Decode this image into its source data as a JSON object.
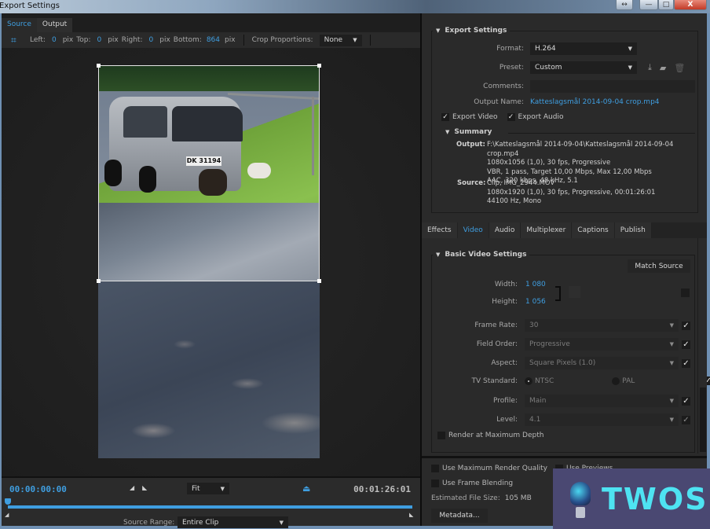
{
  "window": {
    "title": "Export Settings",
    "controls": {
      "swap": "↔",
      "minimize": "—",
      "maximize": "□",
      "close": "X"
    }
  },
  "left_panel": {
    "tabs": [
      {
        "label": "Source",
        "active": true
      },
      {
        "label": "Output",
        "active": false
      }
    ],
    "crop": {
      "icon": "crop-icon",
      "left_label": "Left:",
      "left_value": "0",
      "top_label": "Top:",
      "top_value": "0",
      "right_label": "Right:",
      "right_value": "0",
      "bottom_label": "Bottom:",
      "bottom_value": "864",
      "unit": "pix",
      "proportions_label": "Crop Proportions:",
      "proportions_value": "None"
    },
    "preview": {
      "plate_text": "DK 31194"
    },
    "timeline": {
      "current_time": "00:00:00:00",
      "end_time": "00:01:26:01",
      "zoom_value": "Fit",
      "source_range_label": "Source Range:",
      "source_range_value": "Entire Clip",
      "playhead_position": 0.0
    }
  },
  "right_panel": {
    "export_settings": {
      "title": "Export Settings",
      "format_label": "Format:",
      "format_value": "H.264",
      "preset_label": "Preset:",
      "preset_value": "Custom",
      "comments_label": "Comments:",
      "comments_value": "",
      "output_name_label": "Output Name:",
      "output_name_value": "Katteslagsmål 2014-09-04 crop.mp4",
      "export_video_label": "Export Video",
      "export_video_checked": true,
      "export_audio_label": "Export Audio",
      "export_audio_checked": true
    },
    "summary": {
      "title": "Summary",
      "output_label": "Output:",
      "output_lines": [
        "F:\\Katteslagsmål 2014-09-04\\Katteslagsmål 2014-09-04 crop.mp4",
        "1080x1056 (1,0), 30 fps, Progressive",
        "VBR, 1 pass, Target 10,00 Mbps, Max 12,00 Mbps",
        "AAC, 320 kbps, 48 kHz, 5.1"
      ],
      "source_label": "Source:",
      "source_lines": [
        "Clip, IMG_2944.MOV",
        "1080x1920 (1,0), 30 fps, Progressive, 00:01:26:01",
        "44100 Hz, Mono"
      ]
    },
    "tabs": [
      {
        "label": "Effects",
        "active": false
      },
      {
        "label": "Video",
        "active": true
      },
      {
        "label": "Audio",
        "active": false
      },
      {
        "label": "Multiplexer",
        "active": false
      },
      {
        "label": "Captions",
        "active": false
      },
      {
        "label": "Publish",
        "active": false
      }
    ],
    "basic_video": {
      "title": "Basic Video Settings",
      "match_source_label": "Match Source",
      "width_label": "Width:",
      "width_value": "1 080",
      "height_label": "Height:",
      "height_value": "1 056",
      "frame_rate_label": "Frame Rate:",
      "frame_rate_value": "30",
      "field_order_label": "Field Order:",
      "field_order_value": "Progressive",
      "aspect_label": "Aspect:",
      "aspect_value": "Square Pixels (1.0)",
      "tv_standard_label": "TV Standard:",
      "tv_ntsc_label": "NTSC",
      "tv_pal_label": "PAL",
      "tv_selected": "NTSC",
      "profile_label": "Profile:",
      "profile_value": "Main",
      "level_label": "Level:",
      "level_value": "4.1",
      "render_max_depth_label": "Render at Maximum Depth",
      "render_max_depth_checked": false
    },
    "bottom": {
      "max_render_quality_label": "Use Maximum Render Quality",
      "max_render_quality_checked": false,
      "use_previews_label": "Use Previews",
      "frame_blending_label": "Use Frame Blending",
      "frame_blending_checked": false,
      "estimated_size_label": "Estimated File Size:",
      "estimated_size_value": "105 MB",
      "metadata_label": "Metadata..."
    }
  },
  "watermark": {
    "text": "TWOS"
  }
}
